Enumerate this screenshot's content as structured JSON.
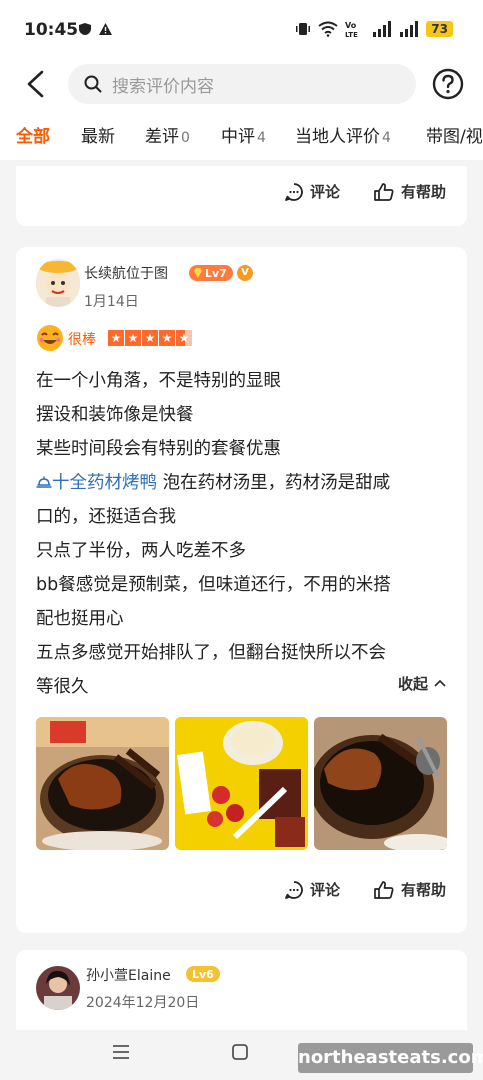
{
  "status_bar": {
    "time": "10:45",
    "battery": "73"
  },
  "search": {
    "placeholder": "搜索评价内容"
  },
  "tabs": [
    {
      "label": "全部",
      "count": ""
    },
    {
      "label": "最新",
      "count": ""
    },
    {
      "label": "差评",
      "count": "0"
    },
    {
      "label": "中评",
      "count": "4"
    },
    {
      "label": "当地人评价",
      "count": "4"
    },
    {
      "label": "带图/视",
      "count": ""
    }
  ],
  "actions": {
    "comment": "评论",
    "helpful": "有帮助",
    "collapse": "收起"
  },
  "review": {
    "username": "长续航位于图",
    "level": "Lv7",
    "verified": "V",
    "date": "1月14日",
    "rating_word": "很棒",
    "rating": 4.5,
    "lines": [
      "在一个小角落，不是特别的显眼",
      "摆设和装饰像是快餐",
      "某些时间段会有特别的套餐优惠",
      "泡在药材汤里，药材汤是甜咸",
      "口的，还挺适合我",
      "只点了半份，两人吃差不多",
      "bb餐感觉是预制菜，但味道还行，不用的米搭",
      "配也挺用心",
      "五点多感觉开始排队了，但翻台挺快所以不会",
      "等很久"
    ],
    "dish_tag": "十全药材烤鸭"
  },
  "next_review": {
    "username": "孙小萱Elaine",
    "level": "Lv6",
    "date": "2024年12月20日"
  },
  "watermark": "northeasteats.com",
  "colors": {
    "accent": "#ff5a00",
    "link": "#2f6fb7",
    "star": "#ff6a2b"
  }
}
